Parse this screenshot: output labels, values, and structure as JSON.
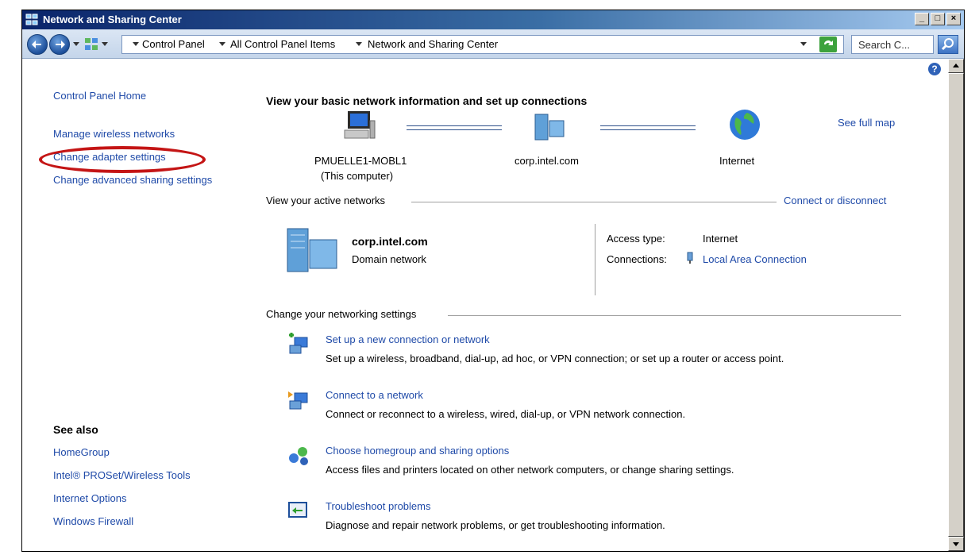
{
  "window": {
    "title": "Network and Sharing Center",
    "minimize": "_",
    "maximize": "□",
    "close": "×"
  },
  "address": {
    "crumbs": [
      "Control Panel",
      "All Control Panel Items",
      "Network and Sharing Center"
    ],
    "search_placeholder": "Search C..."
  },
  "sidebar": {
    "home": "Control Panel Home",
    "tasks": [
      "Manage wireless networks",
      "Change adapter settings",
      "Change advanced sharing settings"
    ],
    "see_also_title": "See also",
    "see_also": [
      "HomeGroup",
      "Intel® PROSet/Wireless Tools",
      "Internet Options",
      "Windows Firewall"
    ]
  },
  "main": {
    "heading": "View your basic network information and set up connections",
    "see_full_map": "See full map",
    "map": {
      "computer_name": "PMUELLE1-MOBL1",
      "computer_sub": "(This computer)",
      "domain": "corp.intel.com",
      "internet": "Internet"
    },
    "active_networks_label": "View your active networks",
    "connect_disconnect": "Connect or disconnect",
    "network": {
      "name": "corp.intel.com",
      "type": "Domain network",
      "access_type_label": "Access type:",
      "access_type_value": "Internet",
      "connections_label": "Connections:",
      "connections_value": "Local Area Connection"
    },
    "change_settings_label": "Change your networking settings",
    "tasks": [
      {
        "title": "Set up a new connection or network",
        "desc": "Set up a wireless, broadband, dial-up, ad hoc, or VPN connection; or set up a router or access point."
      },
      {
        "title": "Connect to a network",
        "desc": "Connect or reconnect to a wireless, wired, dial-up, or VPN network connection."
      },
      {
        "title": "Choose homegroup and sharing options",
        "desc": "Access files and printers located on other network computers, or change sharing settings."
      },
      {
        "title": "Troubleshoot problems",
        "desc": "Diagnose and repair network problems, or get troubleshooting information."
      }
    ]
  }
}
